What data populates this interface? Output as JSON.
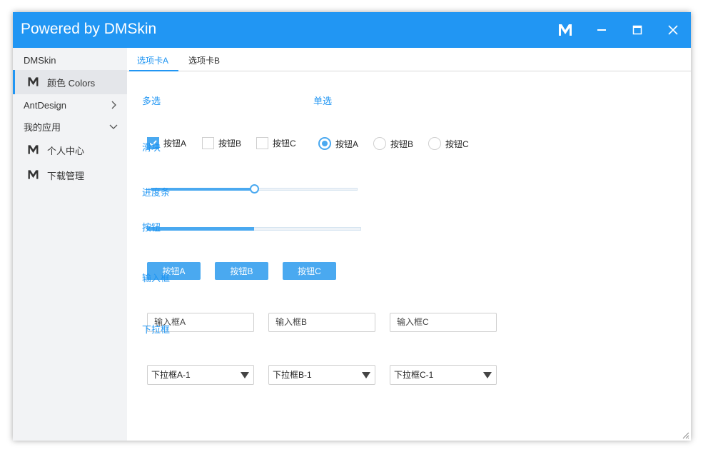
{
  "window": {
    "title": "Powered by DMSkin",
    "accent_color": "#2196f3",
    "controls": [
      "m-logo-icon",
      "minimize-icon",
      "maximize-icon",
      "close-icon"
    ]
  },
  "sidebar": {
    "header": "DMSkin",
    "items": [
      {
        "label": "颜色 Colors",
        "icon": "m-logo-icon",
        "active": true
      },
      {
        "label": "AntDesign",
        "chevron": "chevron-right-icon"
      },
      {
        "label": "我的应用",
        "chevron": "chevron-down-icon"
      },
      {
        "label": "个人中心",
        "icon": "m-logo-icon"
      },
      {
        "label": "下载管理",
        "icon": "m-logo-icon"
      }
    ]
  },
  "tabs": [
    {
      "label": "选项卡A",
      "active": true
    },
    {
      "label": "选项卡B",
      "active": false
    }
  ],
  "sections": {
    "multi": "多选",
    "single": "单选",
    "slider": "滑块",
    "progress": "进度条",
    "buttons": "按钮",
    "inputs": "输入框",
    "dropdowns": "下拉框"
  },
  "checkboxes": [
    {
      "label": "按钮A",
      "checked": true
    },
    {
      "label": "按钮B",
      "checked": false
    },
    {
      "label": "按钮C",
      "checked": false
    }
  ],
  "radios": [
    {
      "label": "按钮A",
      "selected": true
    },
    {
      "label": "按钮B",
      "selected": false
    },
    {
      "label": "按钮C",
      "selected": false
    }
  ],
  "slider_value": 0.5,
  "progress_value": 0.5,
  "buttons": [
    "按钮A",
    "按钮B",
    "按钮C"
  ],
  "inputs": [
    {
      "placeholder": "输入框A"
    },
    {
      "placeholder": "输入框B"
    },
    {
      "placeholder": "输入框C"
    }
  ],
  "dropdowns": [
    {
      "value": "下拉框A-1"
    },
    {
      "value": "下拉框B-1"
    },
    {
      "value": "下拉框C-1"
    }
  ]
}
